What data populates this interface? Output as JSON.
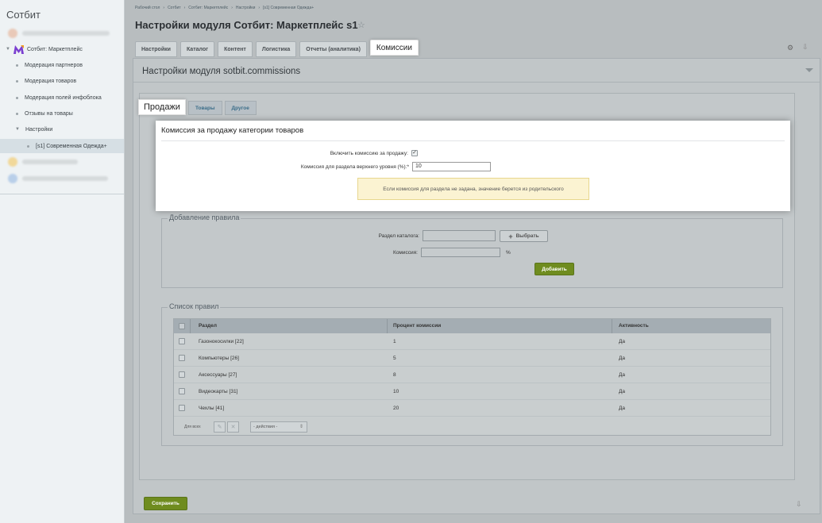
{
  "sidebar": {
    "title": "Сотбит",
    "module_label": "Сотбит: Маркетплейс",
    "items": [
      {
        "label": "Модерация партнеров"
      },
      {
        "label": "Модерация товаров"
      },
      {
        "label": "Модерация полей инфоблока"
      },
      {
        "label": "Отзывы на товары"
      }
    ],
    "settings_label": "Настройки",
    "active_item": "[s1] Современная Одежда+"
  },
  "header": {
    "breadcrumb": [
      "Рабочий стол",
      "Сотбит",
      "Сотбит: Маркетплейс",
      "Настройки",
      "[s1] Современная Одежда+"
    ],
    "breadcrumb_sep": "›",
    "title": "Настройки модуля Сотбит: Маркетплейс s1"
  },
  "tabs": [
    "Настройки",
    "Каталог",
    "Контент",
    "Логистика",
    "Отчеты (аналитика)"
  ],
  "tab_active": "Комиссии",
  "panel": {
    "title": "Настройки модуля sotbit.commissions",
    "subtab_active": "Продажи",
    "subtabs": [
      "Товары",
      "Другое"
    ]
  },
  "category_commission": {
    "title": "Комиссия за продажу категории товаров",
    "enable_label": "Включить комиссию за продажу:",
    "enable_checked": "✓",
    "top_level_label": "Комиссия для раздела верхнего уровня (%):*",
    "top_level_value": "10",
    "note": "Если комиссия для раздела не задана, значение берется из родительского"
  },
  "add_rule": {
    "legend": "Добавление правила",
    "section_label": "Раздел каталога:",
    "select_button": "Выбрать",
    "commission_label": "Комиссия:",
    "percent": "%",
    "add_button": "Добавить"
  },
  "rules": {
    "legend": "Список правил",
    "columns": [
      "Раздел",
      "Процент комиссии",
      "Активность"
    ],
    "rows": [
      {
        "section": "Газонокосилки [22]",
        "percent": "1",
        "active": "Да"
      },
      {
        "section": "Компьютеры [26]",
        "percent": "5",
        "active": "Да"
      },
      {
        "section": "Аксессуары [27]",
        "percent": "8",
        "active": "Да"
      },
      {
        "section": "Видеокарты [31]",
        "percent": "10",
        "active": "Да"
      },
      {
        "section": "Чехлы [41]",
        "percent": "20",
        "active": "Да"
      }
    ],
    "footer_label": "Для всех",
    "actions_placeholder": "- действия -"
  },
  "save_button": "Сохранить",
  "colors": {
    "accent_green": "#6f8c1f",
    "link_blue": "#3c6e8a",
    "note_bg": "#fbf3d2"
  }
}
